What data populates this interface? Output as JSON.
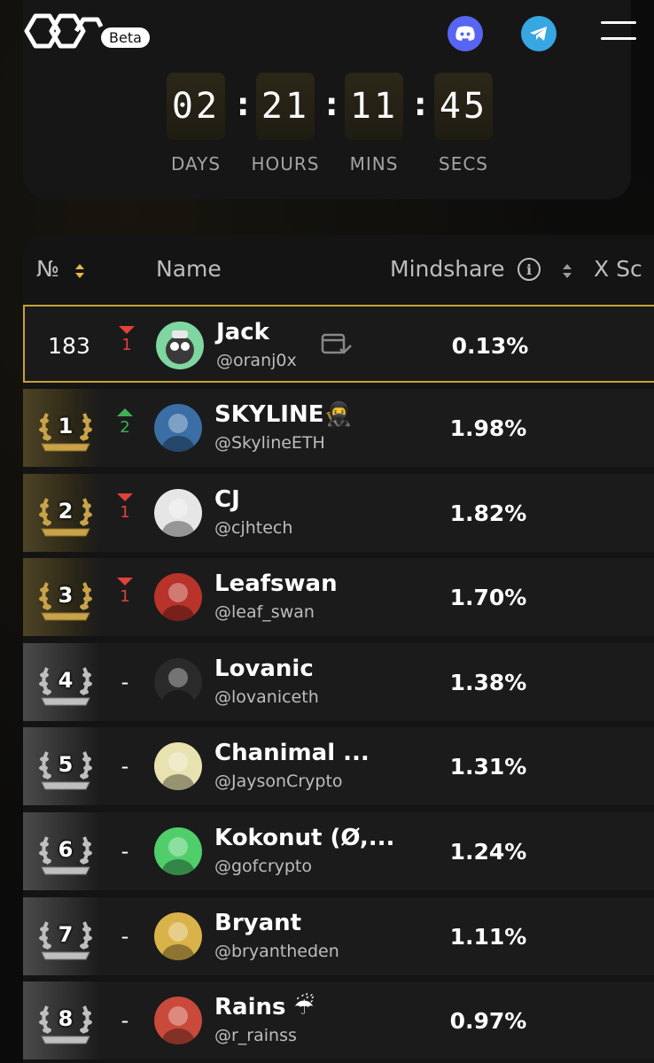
{
  "header": {
    "beta_label": "Beta",
    "icons": [
      "logo-icon",
      "discord-icon",
      "telegram-icon",
      "menu-icon"
    ]
  },
  "countdown": {
    "days": "02",
    "hours": "21",
    "mins": "11",
    "secs": "45",
    "days_label": "DAYS",
    "hours_label": "HOURS",
    "mins_label": "MINS",
    "secs_label": "SECS"
  },
  "table": {
    "col_rank": "№",
    "col_name": "Name",
    "col_mindshare": "Mindshare",
    "col_x": "X Sc",
    "current_user": {
      "rank": "183",
      "delta": "1",
      "delta_dir": "down",
      "name": "Jack",
      "handle": "@oranj0x",
      "mindshare": "0.13%"
    },
    "rows": [
      {
        "rank": "1",
        "delta": "2",
        "delta_dir": "up",
        "name": "SKYLINE🥷",
        "handle": "@SkylineETH",
        "mindshare": "1.98%",
        "tier": "gold"
      },
      {
        "rank": "2",
        "delta": "1",
        "delta_dir": "down",
        "name": "CJ",
        "handle": "@cjhtech",
        "mindshare": "1.82%",
        "tier": "gold"
      },
      {
        "rank": "3",
        "delta": "1",
        "delta_dir": "down",
        "name": "Leafswan",
        "handle": "@leaf_swan",
        "mindshare": "1.70%",
        "tier": "gold"
      },
      {
        "rank": "4",
        "delta": "-",
        "delta_dir": "none",
        "name": "Lovanic",
        "handle": "@lovaniceth",
        "mindshare": "1.38%",
        "tier": "silver"
      },
      {
        "rank": "5",
        "delta": "-",
        "delta_dir": "none",
        "name": "Chanimal ...",
        "handle": "@JaysonCrypto",
        "mindshare": "1.31%",
        "tier": "silver"
      },
      {
        "rank": "6",
        "delta": "-",
        "delta_dir": "none",
        "name": "Kokonut (Ø,...",
        "handle": "@gofcrypto",
        "mindshare": "1.24%",
        "tier": "silver"
      },
      {
        "rank": "7",
        "delta": "-",
        "delta_dir": "none",
        "name": "Bryant",
        "handle": "@bryantheden",
        "mindshare": "1.11%",
        "tier": "silver"
      },
      {
        "rank": "8",
        "delta": "-",
        "delta_dir": "none",
        "name": "Rains ☔",
        "handle": "@r_rainss",
        "mindshare": "0.97%",
        "tier": "silver"
      }
    ]
  }
}
